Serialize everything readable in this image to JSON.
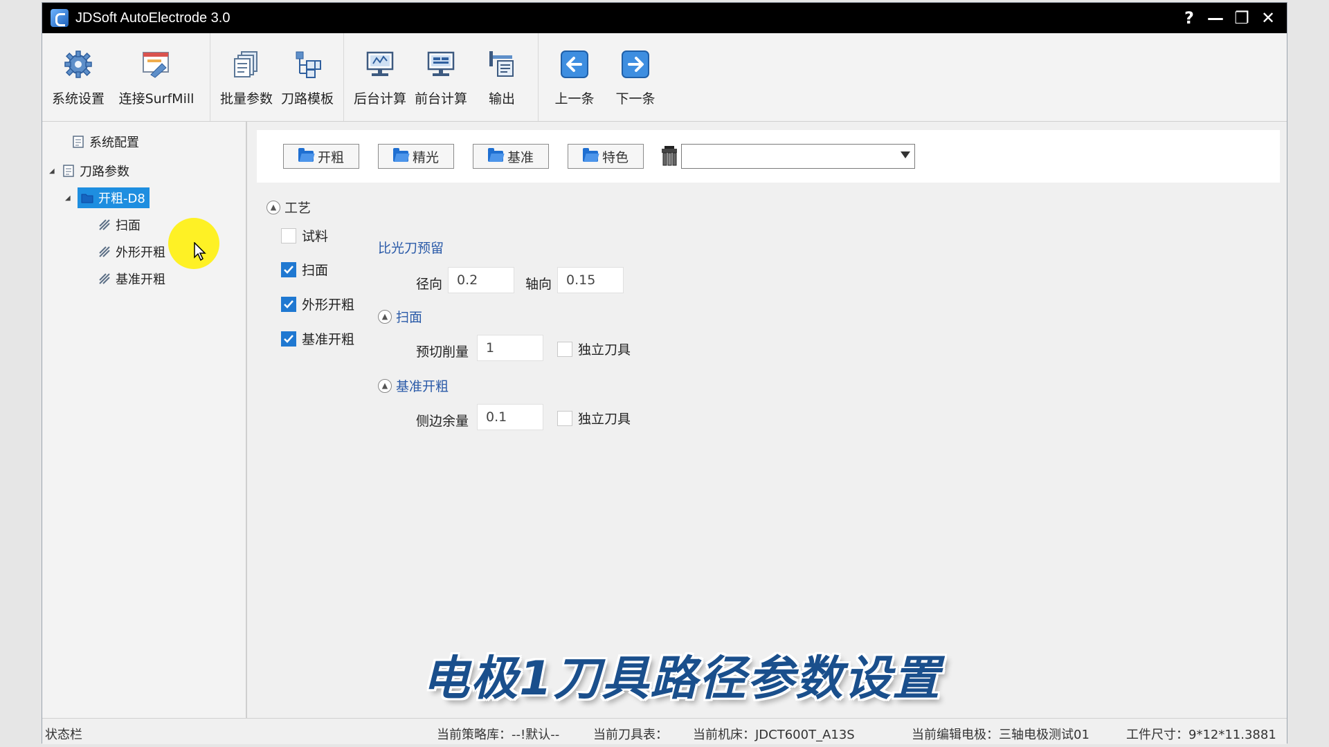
{
  "window": {
    "title": "JDSoft AutoElectrode 3.0"
  },
  "title_controls": {
    "help": "?",
    "minimize": "—",
    "restore": "❐",
    "close": "✕"
  },
  "toolbar": {
    "items": [
      {
        "label": "系统设置",
        "icon": "gear-icon"
      },
      {
        "label": "连接SurfMill",
        "icon": "surfmill-icon"
      },
      {
        "label": "批量参数",
        "icon": "batch-params-icon"
      },
      {
        "label": "刀路模板",
        "icon": "toolpath-template-icon"
      },
      {
        "label": "后台计算",
        "icon": "background-compute-icon"
      },
      {
        "label": "前台计算",
        "icon": "foreground-compute-icon"
      },
      {
        "label": "输出",
        "icon": "output-icon"
      },
      {
        "label": "上一条",
        "icon": "arrow-left-icon"
      },
      {
        "label": "下一条",
        "icon": "arrow-right-icon"
      }
    ]
  },
  "tree": {
    "system_config": "系统配置",
    "toolpath_params": "刀路参数",
    "selected_node": "开粗-D8",
    "children": [
      "扫面",
      "外形开粗",
      "基准开粗"
    ]
  },
  "categories": [
    "开粗",
    "精光",
    "基准",
    "特色"
  ],
  "combo": {
    "value": ""
  },
  "process": {
    "header": "工艺",
    "checks": [
      {
        "label": "试料",
        "checked": false
      },
      {
        "label": "扫面",
        "checked": true
      },
      {
        "label": "外形开粗",
        "checked": true
      },
      {
        "label": "基准开粗",
        "checked": true
      }
    ],
    "allowance_label": "比光刀预留",
    "radial_label": "径向",
    "radial_value": "0.2",
    "axial_label": "轴向",
    "axial_value": "0.15",
    "sweep_header": "扫面",
    "precut_label": "预切削量",
    "precut_value": "1",
    "independent_tool_label": "独立刀具",
    "datum_header": "基准开粗",
    "side_allowance_label": "侧边余量",
    "side_allowance_value": "0.1",
    "independent_tool_label_2": "独立刀具"
  },
  "caption": "电极1刀具路径参数设置",
  "status": {
    "label": "状态栏",
    "strategy": "当前策略库：--!默认--",
    "tool_table": "当前刀具表：",
    "machine": "当前机床：JDCT600T_A13S",
    "electrode": "当前编辑电极：三轴电极测试01",
    "size": "工件尺寸：9*12*11.3881"
  },
  "colors": {
    "accent": "#1e8ee0",
    "checkbox": "#1f78d1",
    "link": "#2a5aa8",
    "caption": "#1a4f8c"
  }
}
